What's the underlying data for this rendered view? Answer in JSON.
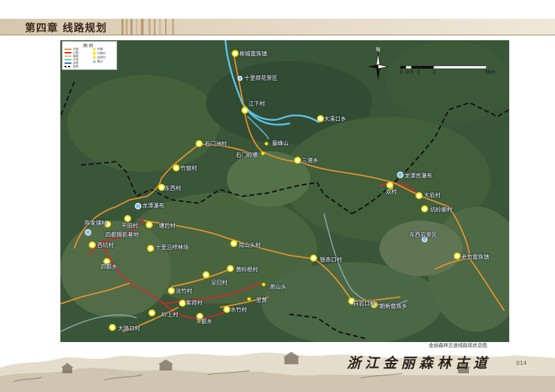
{
  "header": {
    "chapter_title": "第四章  线路规划"
  },
  "legend": {
    "title": "图 例",
    "items": [
      {
        "label": "古道",
        "color": "#e8952c",
        "kind": "line"
      },
      {
        "label": "公路",
        "color": "#d62828",
        "kind": "line"
      },
      {
        "label": "绿道",
        "color": "#f2c244",
        "kind": "line"
      },
      {
        "label": "河流",
        "color": "#5bc3ea",
        "kind": "line"
      },
      {
        "label": "水库",
        "color": "#2f6fb0",
        "kind": "line"
      },
      {
        "label": "县界",
        "color": "#111111",
        "kind": "dash"
      },
      {
        "label": "乡镇",
        "color": "#f5e400",
        "kind": "dot"
      },
      {
        "label": "行政村",
        "color": "#f5e400",
        "kind": "dot"
      },
      {
        "label": "自然村",
        "color": "#f5e400",
        "kind": "dot"
      },
      {
        "label": "景点",
        "color": "#8dc6e8",
        "kind": "dot"
      }
    ]
  },
  "map": {
    "place_labels": [
      {
        "id": "liuchengshe",
        "text": "柳城畲族镇"
      },
      {
        "id": "shilihe",
        "text": "十里荷花景区"
      },
      {
        "id": "jiangxia",
        "text": "江下村"
      },
      {
        "id": "daxikou",
        "text": "大溪口乡"
      },
      {
        "id": "shimenzhou",
        "text": "石门洲村"
      },
      {
        "id": "tongfengshan",
        "text": "童峰山"
      },
      {
        "id": "shimenling",
        "text": "石门岭腰"
      },
      {
        "id": "sangang",
        "text": "三港乡"
      },
      {
        "id": "zhuchuang",
        "text": "竹窗村"
      },
      {
        "id": "dongxi",
        "text": "东西村"
      },
      {
        "id": "longtanbei",
        "text": "龙潭背瀑布"
      },
      {
        "id": "shuangcun",
        "text": "双村"
      },
      {
        "id": "dalian",
        "text": "大岩村"
      },
      {
        "id": "longtanpubu",
        "text": "龙潭瀑布"
      },
      {
        "id": "kengling",
        "text": "坑岭脚村"
      },
      {
        "id": "chenjiapu",
        "text": "陈家铺村"
      },
      {
        "id": "pingtian",
        "text": "平田村"
      },
      {
        "id": "tanghou",
        "text": "塘后村"
      },
      {
        "id": "sidushe",
        "text": "四都摄影基地"
      },
      {
        "id": "xixi",
        "text": "西坑村"
      },
      {
        "id": "shilisong",
        "text": "十里沿梓林场"
      },
      {
        "id": "dongxiyan",
        "text": "东西岩景区"
      },
      {
        "id": "gangshantou",
        "text": "岗山头村"
      },
      {
        "id": "laozhu",
        "text": "老竹畲族镇"
      },
      {
        "id": "sidu",
        "text": "四都乡"
      },
      {
        "id": "yinchikou",
        "text": "银赤口村"
      },
      {
        "id": "huanglinggen",
        "text": "黄岭根村"
      },
      {
        "id": "xuanhui",
        "text": "呈回村"
      },
      {
        "id": "yanshantou",
        "text": "燕山头"
      },
      {
        "id": "danzhu",
        "text": "淡竹村"
      },
      {
        "id": "zihe",
        "text": "紫荷村"
      },
      {
        "id": "baishakou",
        "text": "白岩口村"
      },
      {
        "id": "lihuang",
        "text": "里黄"
      },
      {
        "id": "shuizhu",
        "text": "水竹村"
      },
      {
        "id": "sanduxiang",
        "text": "三都乡"
      },
      {
        "id": "zhaoxinshe",
        "text": "朗新畲族乡"
      },
      {
        "id": "lingshang",
        "text": "岭上村"
      },
      {
        "id": "dalukou",
        "text": "大路口村"
      }
    ],
    "north_label": "N",
    "scale": {
      "ticks": [
        "0",
        "0.5",
        "1",
        "2"
      ],
      "end": "5km"
    }
  },
  "caption": "金丽森林古道线路现状总图",
  "footer": {
    "brand": "浙江金丽森林古道",
    "page_number": "014"
  }
}
